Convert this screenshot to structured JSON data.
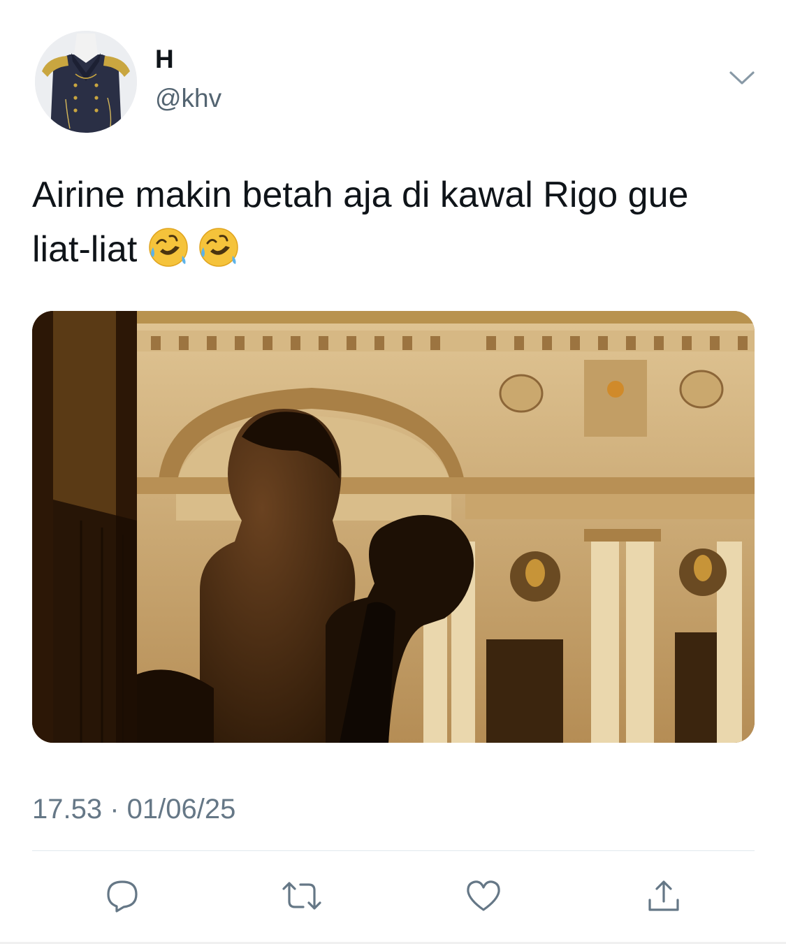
{
  "tweet": {
    "author": {
      "name": "H",
      "handle": "@khv"
    },
    "text": "Airine makin betah aja di kawal Rigo gue liat-liat ",
    "emojis": [
      "rolling-on-the-floor-laughing",
      "rolling-on-the-floor-laughing"
    ],
    "timestamp": "17.53 · 01/06/25"
  },
  "actions": [
    "reply-icon",
    "retweet-icon",
    "like-icon",
    "share-icon"
  ],
  "colors": {
    "text": "#0f1419",
    "secondary": "#536471",
    "timestamp": "#657786",
    "divider": "#e1e8ed"
  }
}
